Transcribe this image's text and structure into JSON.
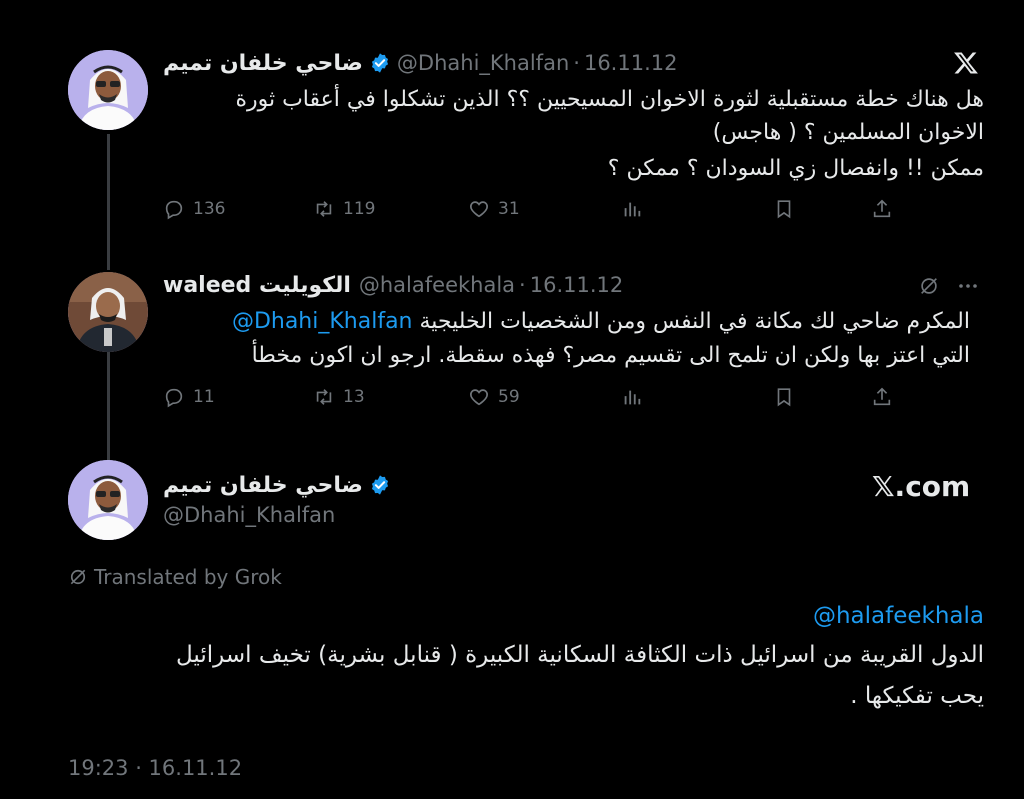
{
  "tweet1": {
    "display_name": "ضاحي خلفان تميم",
    "handle": "@Dhahi_Khalfan",
    "date": "16.11.12",
    "lines": [
      "هل هناك خطة مستقبلية لثورة الاخوان المسيحيين ؟؟ الذين تشكلوا في أعقاب ثورة",
      "الاخوان المسلمين ؟ ( هاجس)",
      "ممكن !! وانفصال زي السودان ؟ ممكن ؟"
    ],
    "stats": {
      "replies": "136",
      "reposts": "119",
      "likes": "31"
    }
  },
  "tweet2": {
    "display_name": "waleed الكويليت",
    "handle": "@halafeekhala",
    "date": "16.11.12",
    "mention": "@Dhahi_Khalfan",
    "line1_rest": "المكرم ضاحي لك مكانة في النفس ومن الشخصيات الخليجية",
    "line2": "التي اعتز بها ولكن ان تلمح الى تقسيم مصر؟ فهذه سقطة. ارجو ان اكون مخطأ",
    "stats": {
      "replies": "11",
      "reposts": "13",
      "likes": "59"
    }
  },
  "main_tweet": {
    "display_name": "ضاحي خلفان تميم",
    "handle": "@Dhahi_Khalfan",
    "watermark": "𝕏.com",
    "translated_label": "Translated by Grok",
    "mention": "@halafeekhala",
    "lines": [
      "الدول القريبة من اسرائيل ذات الكثافة السكانية الكبيرة ( قنابل بشرية) تخيف اسرائيل",
      "يحب تفكيكها ."
    ],
    "timestamp": "19:23 · 16.11.12"
  },
  "colors": {
    "background": "#000000",
    "text": "#e7e9ea",
    "muted": "#71767b",
    "accent": "#1d9bf0",
    "verified": "#1d9bf0"
  },
  "icons": [
    "x-logo-icon",
    "verified-badge-icon",
    "reply-icon",
    "repost-icon",
    "like-icon",
    "views-icon",
    "bookmark-icon",
    "share-icon",
    "grok-icon",
    "more-icon"
  ]
}
